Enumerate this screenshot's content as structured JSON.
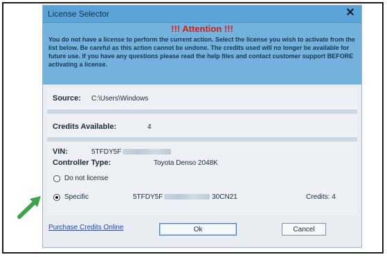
{
  "window": {
    "title": "License Selector",
    "close_icon": "close-icon"
  },
  "warning": {
    "heading": "!!! Attention !!!",
    "message": "You do not have a license to perform the current action. Select the license you wish to activate from the list below. Be careful as this action cannot be undone. The credits used will no longer be available for future use. If you have any questions please read the help files and contact customer support BEFORE activating a license."
  },
  "source": {
    "label": "Source:",
    "value": "C:\\Users\\Windows"
  },
  "credits": {
    "label": "Credits Available:",
    "value": "4"
  },
  "vehicle": {
    "vin_label": "VIN:",
    "vin_value": "5TFDY5F",
    "controller_label": "Controller Type:",
    "controller_value": "Toyota Denso 2048K"
  },
  "options": {
    "do_not_license": "Do not license",
    "specific": "Specific",
    "specific_code_prefix": "5TFDY5F",
    "specific_code_suffix": "30CN21",
    "specific_credits": "Credits: 4",
    "selected": "Specific"
  },
  "footer": {
    "purchase_link": "Purchase Credits Online",
    "ok_label": "Ok",
    "cancel_label": "Cancel"
  },
  "colors": {
    "titlebar": "#5aa3d6",
    "warning_bg": "#74b2de",
    "attention_red": "#d31f17",
    "arrow_green": "#3ea24a"
  }
}
